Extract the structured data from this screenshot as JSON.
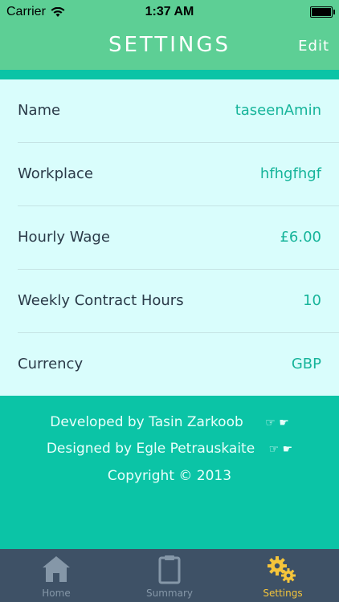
{
  "status_bar": {
    "carrier": "Carrier",
    "time": "1:37 AM"
  },
  "nav": {
    "title": "SETTINGS",
    "edit_label": "Edit"
  },
  "settings": [
    {
      "label": "Name",
      "value": "taseenAmin"
    },
    {
      "label": "Workplace",
      "value": "hfhgfhgf"
    },
    {
      "label": "Hourly Wage",
      "value": "£6.00"
    },
    {
      "label": "Weekly Contract Hours",
      "value": "10"
    },
    {
      "label": "Currency",
      "value": "GBP"
    }
  ],
  "credits": {
    "developed": "Developed by Tasin Zarkoob",
    "designed": "Designed by Egle Petrauskaite",
    "copyright": "Copyright © 2013",
    "hand_glyphs": "☞ ☛"
  },
  "tabs": [
    {
      "label": "Home",
      "icon": "home-icon"
    },
    {
      "label": "Summary",
      "icon": "clipboard-icon"
    },
    {
      "label": "Settings",
      "icon": "gears-icon"
    }
  ],
  "colors": {
    "header": "#5dcf95",
    "accent": "#0bc4a6",
    "list_bg": "#d9fdfc",
    "value_text": "#16b49a",
    "tab_bar": "#3e5166",
    "tab_active": "#f5c53b"
  }
}
